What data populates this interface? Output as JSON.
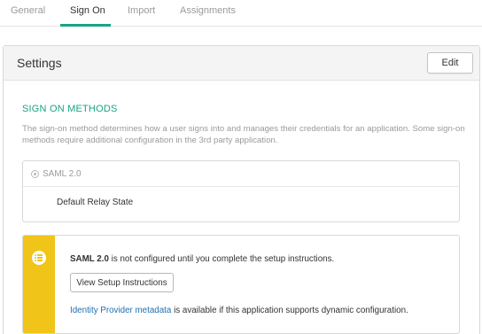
{
  "tabs": [
    {
      "label": "General"
    },
    {
      "label": "Sign On"
    },
    {
      "label": "Import"
    },
    {
      "label": "Assignments"
    }
  ],
  "active_tab": "Sign On",
  "settings": {
    "title": "Settings",
    "edit_label": "Edit"
  },
  "sign_on": {
    "heading": "SIGN ON METHODS",
    "description": "The sign-on method determines how a user signs into and manages their credentials for an application. Some sign-on methods require additional configuration in the 3rd party application.",
    "method_label": "SAML 2.0",
    "relay_state_label": "Default Relay State"
  },
  "callout": {
    "icon": "list-icon",
    "message_bold": "SAML 2.0",
    "message_rest": " is not configured until you complete the setup instructions.",
    "button_label": "View Setup Instructions",
    "link_text": "Identity Provider metadata",
    "link_suffix": " is available if this application supports dynamic configuration."
  },
  "colors": {
    "accent": "#1aa383",
    "warning": "#f0c419",
    "link": "#1f6fb2"
  }
}
